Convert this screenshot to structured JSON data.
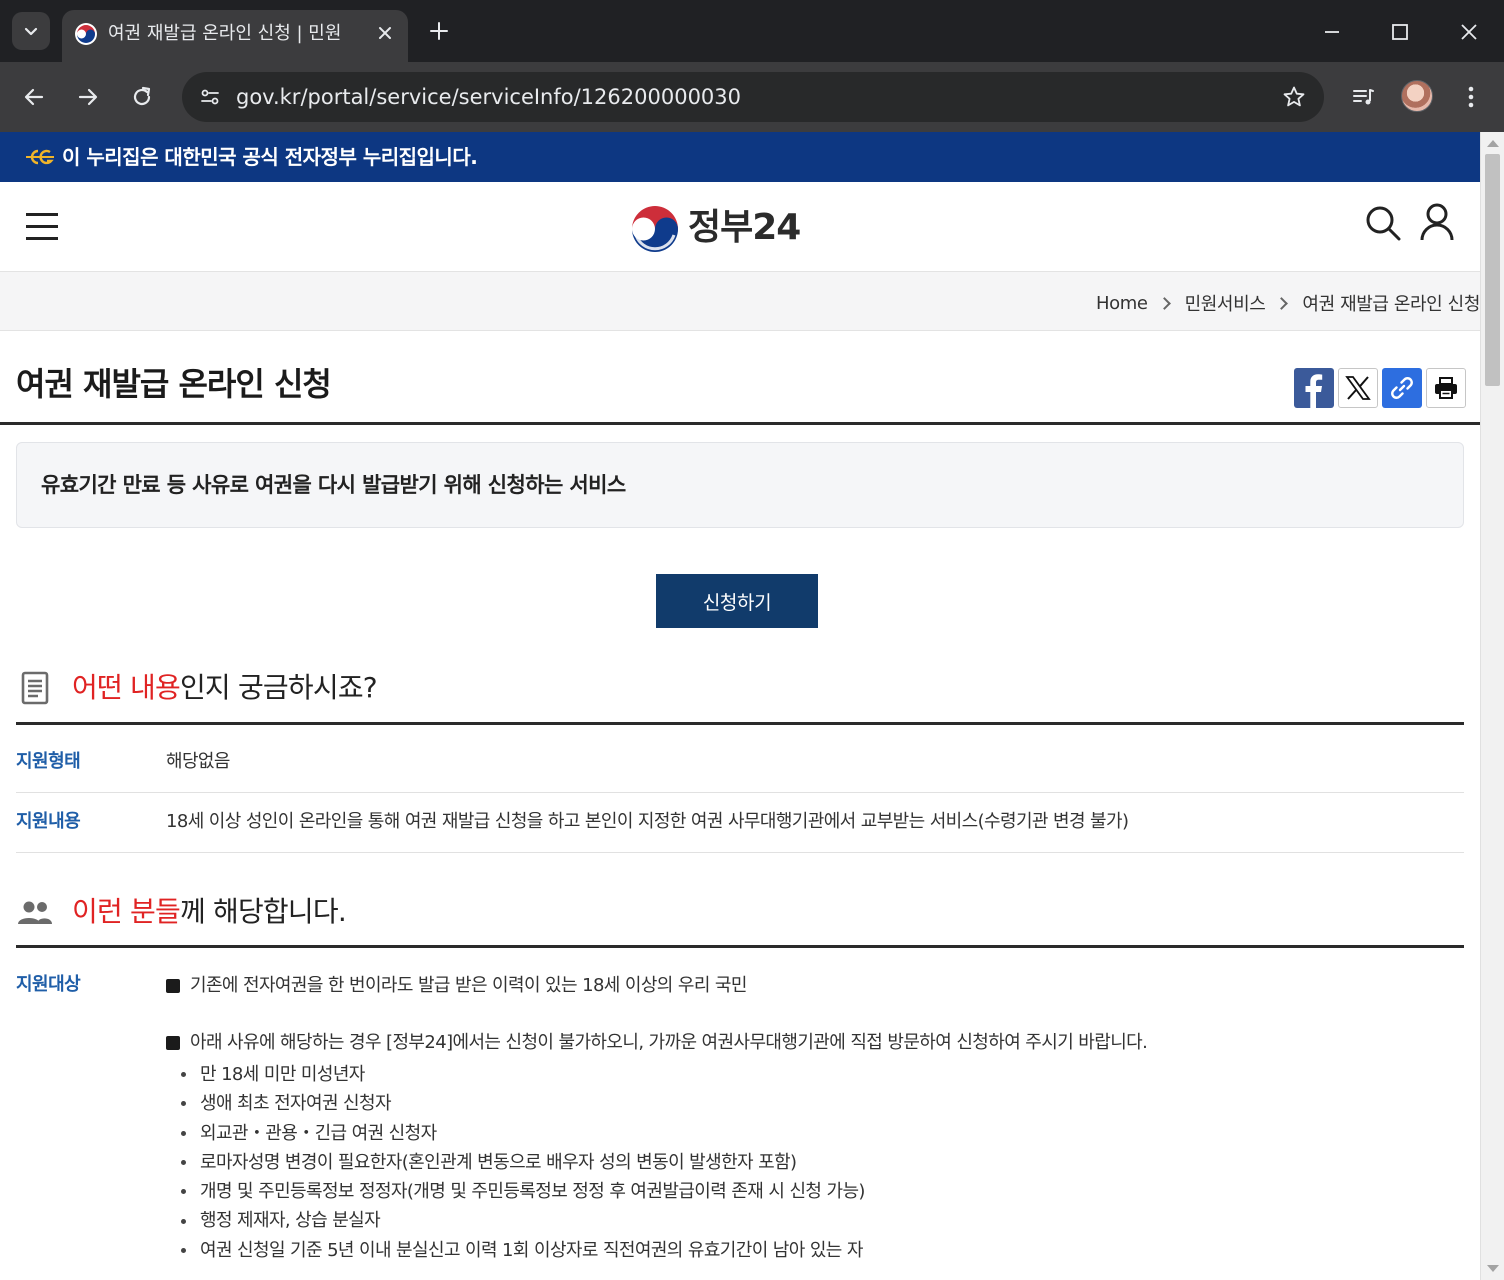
{
  "browser": {
    "tab_title": "여권 재발급 온라인 신청 | 민원",
    "url": "gov.kr/portal/service/serviceInfo/126200000030"
  },
  "banner": {
    "text": "이 누리집은 대한민국 공식 전자정부 누리집입니다."
  },
  "header": {
    "logo_text": "정부24"
  },
  "breadcrumb": {
    "items": [
      "Home",
      "민원서비스",
      "여권 재발급 온라인 신청"
    ]
  },
  "page": {
    "title": "여권 재발급 온라인 신청",
    "summary": "유효기간 만료 등 사유로 여권을 다시 발급받기 위해 신청하는 서비스",
    "apply_label": "신청하기"
  },
  "section_content": {
    "title_accent": "어떤 내용",
    "title_rest": "인지 궁금하시죠?",
    "rows": [
      {
        "label": "지원형태",
        "value": "해당없음"
      },
      {
        "label": "지원내용",
        "value": "18세 이상 성인이 온라인을 통해 여권 재발급 신청을 하고 본인이 지정한 여권 사무대행기관에서 교부받는 서비스(수령기관 변경 불가)"
      }
    ]
  },
  "section_target": {
    "title_accent": "이런 분들",
    "title_rest": "께 해당합니다.",
    "label": "지원대상",
    "item1": "기존에 전자여권을 한 번이라도 발급 받은 이력이 있는 18세 이상의 우리 국민",
    "item2": "아래 사유에 해당하는 경우 [정부24]에서는 신청이 불가하오니, 가까운 여권사무대행기관에 직접 방문하여 신청하여 주시기 바랍니다.",
    "exclusions": [
      "만 18세 미만 미성년자",
      "생애 최초 전자여권 신청자",
      "외교관・관용・긴급 여권 신청자",
      "로마자성명 변경이 필요한자(혼인관계 변동으로 배우자 성의 변동이 발생한자 포함)",
      "개명 및 주민등록정보 정정자(개명 및 주민등록정보 정정 후 여권발급이력 존재 시 신청 가능)",
      "행정 제재자, 상습 분실자",
      "여권 신청일 기준 5년 이내 분실신고 이력 1회 이상자로 직전여권의 유효기간이 남아 있는 자"
    ]
  },
  "colors": {
    "banner_bg": "#0d3782",
    "apply_button_bg": "#113b6b",
    "accent_red": "#e02323",
    "label_blue": "#1f5ea8"
  }
}
